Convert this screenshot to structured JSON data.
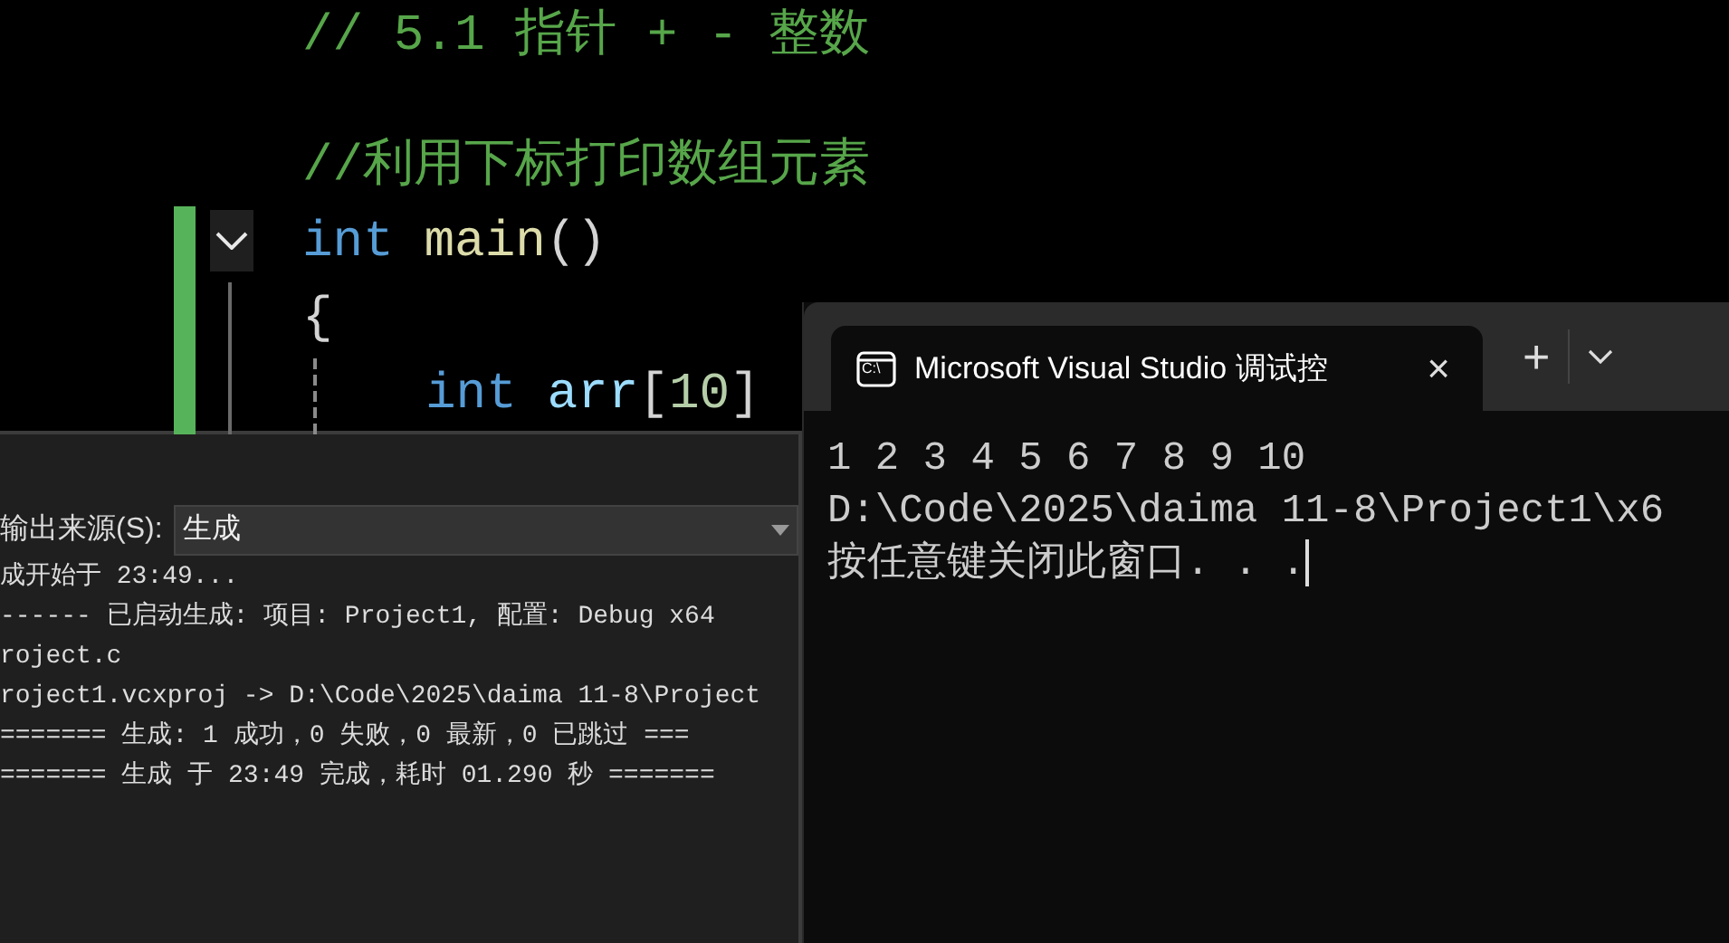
{
  "editor": {
    "lines": [
      {
        "kind": "comment",
        "text": "// 5.1 指针 + - 整数"
      },
      {
        "kind": "blank"
      },
      {
        "kind": "comment",
        "text": "//利用下标打印数组元素"
      },
      {
        "kind": "code",
        "change_marked": true,
        "fold_expanded": true,
        "tokens": [
          {
            "kind": "keyword",
            "text": "int"
          },
          {
            "kind": "function",
            "text": "main",
            "space_before": true
          },
          {
            "kind": "punct",
            "text": "()"
          }
        ]
      },
      {
        "kind": "code",
        "change_marked": true,
        "tokens": [
          {
            "kind": "punct",
            "text": "{"
          }
        ]
      },
      {
        "kind": "code",
        "change_marked": true,
        "indented": true,
        "tokens": [
          {
            "kind": "keyword",
            "text": "int"
          },
          {
            "kind": "variable",
            "text": "arr",
            "space_before": true
          },
          {
            "kind": "punct",
            "text": "["
          },
          {
            "kind": "number",
            "text": "10"
          },
          {
            "kind": "punct",
            "text": "]"
          }
        ]
      }
    ]
  },
  "output": {
    "source_label": "输出来源(S):",
    "source_value": "生成",
    "lines": [
      "成开始于 23:49...",
      "------ 已启动生成: 项目: Project1, 配置: Debug x64",
      "roject.c",
      "roject1.vcxproj -> D:\\Code\\2025\\daima 11-8\\Project",
      "======= 生成: 1 成功，0 失败，0 最新，0 已跳过 ===",
      "======= 生成 于 23:49 完成，耗时 01.290 秒 ======="
    ]
  },
  "console": {
    "tab_icon_text": "C:\\",
    "tab_title": "Microsoft Visual Studio 调试控",
    "tab_close": "×",
    "new_tab": "+",
    "lines": [
      "1 2 3 4 5 6 7 8 9 10",
      "D:\\Code\\2025\\daima 11-8\\Project1\\x6",
      "按任意键关闭此窗口. . ."
    ]
  }
}
